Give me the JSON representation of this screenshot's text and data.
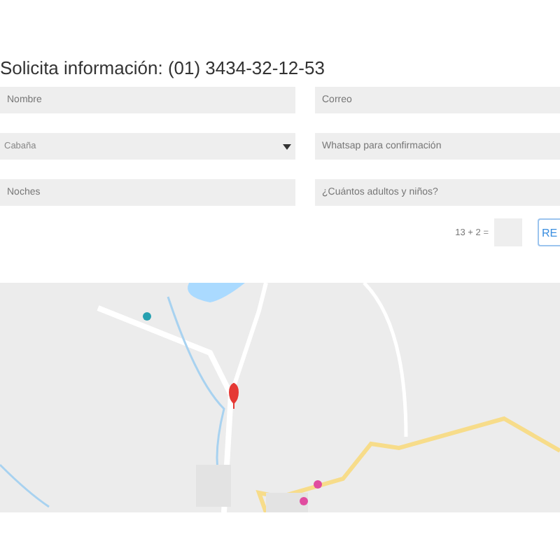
{
  "heading": "Solicita información: (01) 3434-32-12-53",
  "fields": [
    {
      "kind": "text",
      "placeholder": "Nombre"
    },
    {
      "kind": "text",
      "placeholder": "Correo"
    },
    {
      "kind": "select",
      "placeholder": "Cabaña"
    },
    {
      "kind": "text",
      "placeholder": "Whatsap para confirmación"
    },
    {
      "kind": "text",
      "placeholder": "Noches"
    },
    {
      "kind": "text",
      "placeholder": "¿Cuántos adultos y niños?"
    }
  ],
  "captcha": {
    "question": "13 + 2 ="
  },
  "submit_button": "RE"
}
